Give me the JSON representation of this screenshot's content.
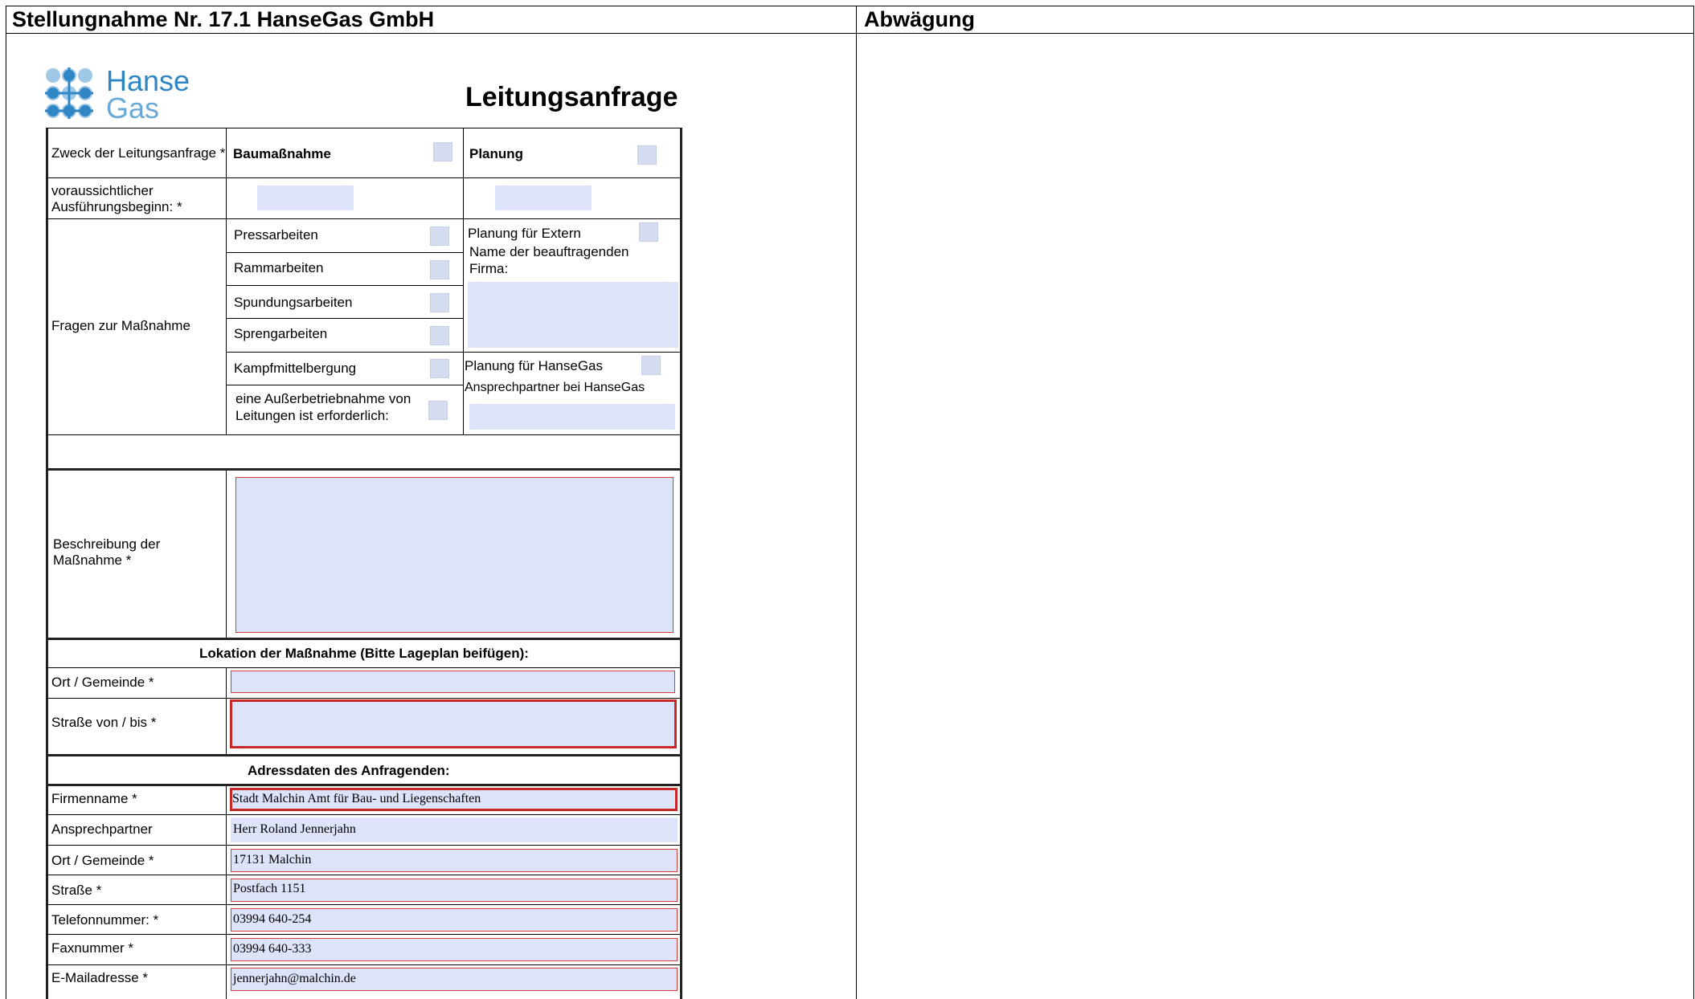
{
  "header": {
    "left_title": "Stellungnahme Nr. 17.1  HanseGas GmbH",
    "right_title": "Abwägung"
  },
  "logo": {
    "line1": "Hanse",
    "line2": "Gas",
    "color": "#2f86c4"
  },
  "form": {
    "title": "Leitungsanfrage",
    "zweck_label": "Zweck der Leitungsanfrage *",
    "baumassnahme": "Baumaßnahme",
    "planung": "Planung",
    "ausfuehrung_label_1": "voraussichtlicher",
    "ausfuehrung_label_2": "Ausführungsbeginn: *",
    "fragen_label": "Fragen zur Maßnahme",
    "fragen_items": [
      "Pressarbeiten",
      "Rammarbeiten",
      "Spundungsarbeiten",
      "Sprengarbeiten",
      "Kampfmittelbergung"
    ],
    "ausserbetrieb_1": "eine Außerbetriebnahme von",
    "ausserbetrieb_2": "Leitungen ist erforderlich:",
    "planung_extern": "Planung für Extern",
    "name_firma_1": "Name der beauftragenden",
    "name_firma_2": "Firma:",
    "planung_hansegas": "Planung für HanseGas",
    "ansprechpartner_hansegas": "Ansprechpartner bei HanseGas",
    "beschreibung_1": "Beschreibung der",
    "beschreibung_2": "Maßnahme *",
    "lokation_header": "Lokation der Maßnahme (Bitte Lageplan beifügen):",
    "ort_gemeinde": "Ort / Gemeinde *",
    "strasse_von_bis": "Straße von / bis *",
    "adress_header": "Adressdaten des Anfragenden:",
    "address_rows": [
      {
        "label": "Firmenname *",
        "value": "Stadt Malchin   Amt für Bau- und Liegenschaften"
      },
      {
        "label": "Ansprechpartner",
        "value": "Herr Roland Jennerjahn"
      },
      {
        "label": "Ort / Gemeinde *",
        "value": "17131 Malchin"
      },
      {
        "label": "Straße *",
        "value": "Postfach 1151"
      },
      {
        "label": "Telefonnummer: *",
        "value": "03994  640-254"
      },
      {
        "label": "Faxnummer *",
        "value": "03994  640-333"
      },
      {
        "label": "E-Mailadresse *",
        "value": "jennerjahn@malchin.de"
      }
    ]
  },
  "colors": {
    "field_fill": "#dde3f8",
    "checkbox_fill": "#d5dcef",
    "required_border": "#d23c3c"
  }
}
